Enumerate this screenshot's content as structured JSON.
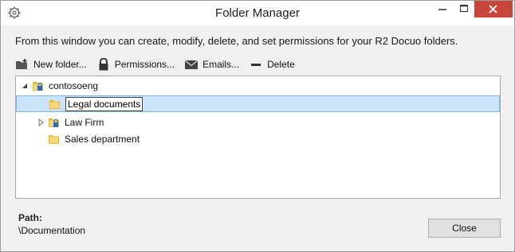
{
  "window": {
    "title": "Folder Manager",
    "icons": {
      "app": "gear-icon",
      "minimize": "minimize-icon",
      "maximize": "maximize-icon",
      "close": "close-icon"
    }
  },
  "intro_text": "From this window you can create, modify, delete, and set permissions for your R2 Docuo folders.",
  "toolbar": {
    "new_folder": "New folder...",
    "permissions": "Permissions...",
    "emails": "Emails...",
    "delete": "Delete"
  },
  "tree": {
    "root": "contosoeng",
    "items": [
      {
        "label": "Legal documents",
        "selected": true,
        "editing": true,
        "locked": false
      },
      {
        "label": "Law Firm",
        "selected": false,
        "editing": false,
        "locked": true,
        "expandable": true
      },
      {
        "label": "Sales department",
        "selected": false,
        "editing": false,
        "locked": false
      }
    ]
  },
  "path": {
    "label": "Path:",
    "value": "\\Documentation"
  },
  "buttons": {
    "close": "Close"
  },
  "colors": {
    "selection": "#cce4fa",
    "close_button": "#c7453b",
    "folder": "#e8b93c"
  }
}
